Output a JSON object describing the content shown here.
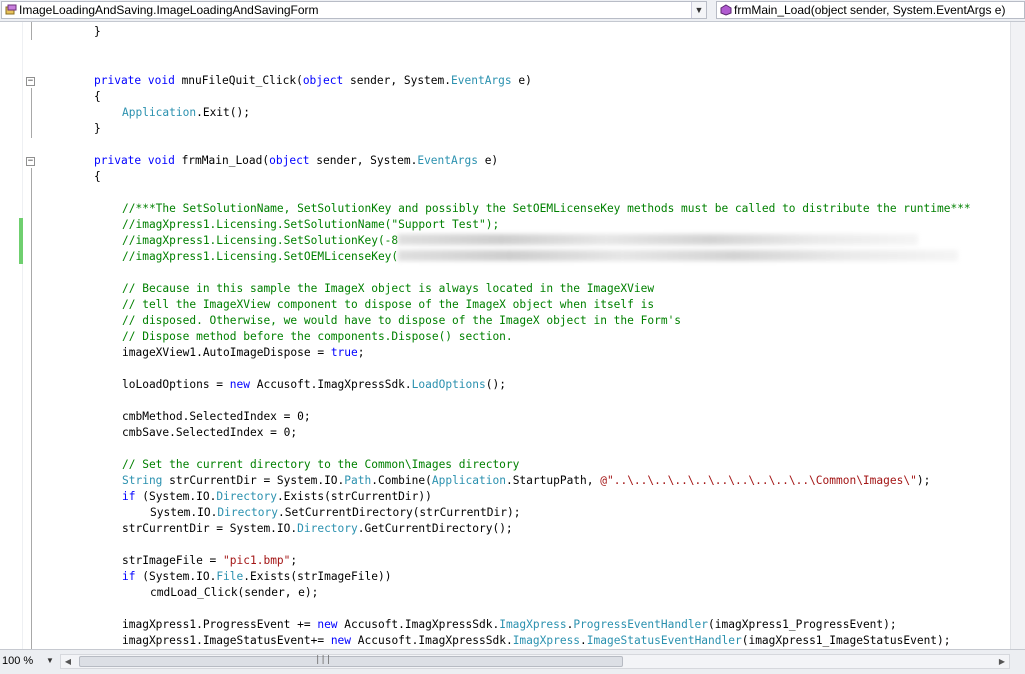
{
  "header": {
    "class_dropdown": "ImageLoadingAndSaving.ImageLoadingAndSavingForm",
    "member_dropdown": "frmMain_Load(object sender, System.EventArgs e)"
  },
  "status": {
    "zoom": "100 %"
  },
  "code": {
    "l01": "}",
    "l04a": "private void ",
    "l04b": "mnuFileQuit_Click(",
    "l04c": "object",
    "l04d": " sender, System.",
    "l04e": "EventArgs",
    "l04f": " e)",
    "l05": "{",
    "l06a": "Application",
    "l06b": ".Exit();",
    "l07": "}",
    "l09a": "private void ",
    "l09b": "frmMain_Load(",
    "l09c": "object",
    "l09d": " sender, System.",
    "l09e": "EventArgs",
    "l09f": " e)",
    "l10": "{",
    "l12": "//***The SetSolutionName, SetSolutionKey and possibly the SetOEMLicenseKey methods must be called to distribute the runtime***",
    "l13": "//imagXpress1.Licensing.SetSolutionName(\"Support Test\");",
    "l14": "//imagXpress1.Licensing.SetSolutionKey(-8",
    "l15": "//imagXpress1.Licensing.SetOEMLicenseKey(",
    "l17": "// Because in this sample the ImageX object is always located in the ImageXView",
    "l18": "// tell the ImageXView component to dispose of the ImageX object when itself is",
    "l19": "// disposed. Otherwise, we would have to dispose of the ImageX object in the Form's",
    "l20": "// Dispose method before the components.Dispose() section.",
    "l21a": "imageXView1.AutoImageDispose = ",
    "l21b": "true",
    "l21c": ";",
    "l23a": "loLoadOptions = ",
    "l23b": "new",
    "l23c": " Accusoft.ImagXpressSdk.",
    "l23d": "LoadOptions",
    "l23e": "();",
    "l25": "cmbMethod.SelectedIndex = 0;",
    "l26": "cmbSave.SelectedIndex = 0;",
    "l28": "// Set the current directory to the Common\\Images directory",
    "l29a": "String",
    "l29b": " strCurrentDir = System.IO.",
    "l29c": "Path",
    "l29d": ".Combine(",
    "l29e": "Application",
    "l29f": ".StartupPath, ",
    "l29g": "@\"..\\..\\..\\..\\..\\..\\..\\..\\..\\..\\Common\\Images\\\"",
    "l29h": ");",
    "l30a": "if",
    "l30b": " (System.IO.",
    "l30c": "Directory",
    "l30d": ".Exists(strCurrentDir))",
    "l31a": "System.IO.",
    "l31b": "Directory",
    "l31c": ".SetCurrentDirectory(strCurrentDir);",
    "l32a": "strCurrentDir = System.IO.",
    "l32b": "Directory",
    "l32c": ".GetCurrentDirectory();",
    "l34a": "strImageFile = ",
    "l34b": "\"pic1.bmp\"",
    "l34c": ";",
    "l35a": "if",
    "l35b": " (System.IO.",
    "l35c": "File",
    "l35d": ".Exists(strImageFile))",
    "l36": "cmdLoad_Click(sender, e);",
    "l38a": "imagXpress1.ProgressEvent += ",
    "l38b": "new",
    "l38c": " Accusoft.ImagXpressSdk.",
    "l38d": "ImagXpress",
    "l38e": ".",
    "l38f": "ProgressEventHandler",
    "l38g": "(imagXpress1_ProgressEvent);",
    "l39a": "imagXpress1.ImageStatusEvent+= ",
    "l39b": "new",
    "l39c": " Accusoft.ImagXpressSdk.",
    "l39d": "ImagXpress",
    "l39e": ".",
    "l39f": "ImageStatusEventHandler",
    "l39g": "(imagXpress1_ImageStatusEvent);"
  },
  "colors": {
    "keyword": "#0000ff",
    "type": "#2b91af",
    "comment": "#008000",
    "string": "#a31515",
    "change_bar": "#6fcf6f"
  },
  "icons": [
    "class-icon",
    "method-icon",
    "collapse-icon",
    "dropdown-arrow-icon",
    "scroll-grip-icon"
  ]
}
